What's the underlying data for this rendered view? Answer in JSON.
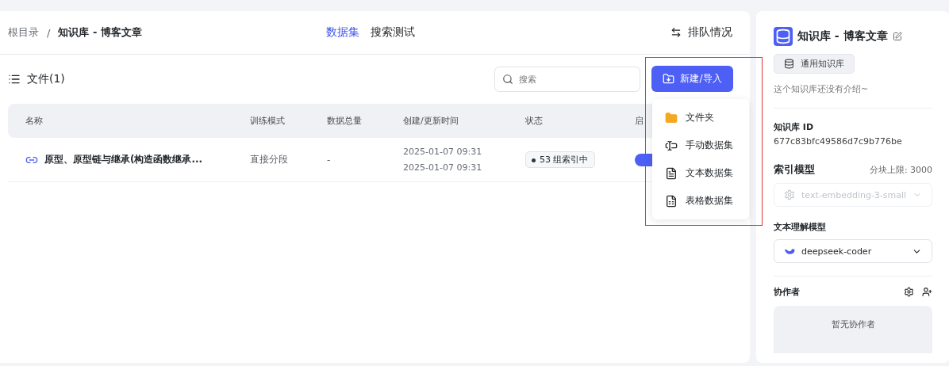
{
  "breadcrumb_separator": "/",
  "breadcrumb": [
    {
      "label": "根目录",
      "current": false
    },
    {
      "label": "知识库 - 博客文章",
      "current": true
    }
  ],
  "tabs": [
    {
      "label": "数据集",
      "selected": true
    },
    {
      "label": "搜索测试",
      "selected": false
    }
  ],
  "queue_button": {
    "label": "排队情况"
  },
  "files_heading": "文件(1)",
  "search": {
    "placeholder": "搜索"
  },
  "create_button": {
    "label": "新建/导入"
  },
  "create_menu": [
    {
      "kind": "folder",
      "label": "文件夹"
    },
    {
      "kind": "manual",
      "label": "手动数据集"
    },
    {
      "kind": "text",
      "label": "文本数据集"
    },
    {
      "kind": "table",
      "label": "表格数据集"
    }
  ],
  "table": {
    "columns": [
      "名称",
      "训练模式",
      "数据总量",
      "创建/更新时间",
      "状态",
      "启"
    ],
    "rows": [
      {
        "name": "原型、原型链与继承(构造函数继承...",
        "mode": "直接分段",
        "total": "-",
        "created": "2025-01-07 09:31",
        "updated": "2025-01-07 09:31",
        "status": "53 组索引中",
        "enabled": true
      }
    ]
  },
  "sidebar": {
    "title": "知识库 - 博客文章",
    "type_tag": "通用知识库",
    "description": "这个知识库还没有介绍~",
    "id_label": "知识库 ID",
    "id_value": "677c83bfc49586d7c9b776be",
    "index_model": {
      "label": "索引模型",
      "limit": "分块上限: 3000",
      "value": "text-embedding-3-small",
      "disabled": true
    },
    "text_model": {
      "label": "文本理解模型",
      "value": "deepseek-coder",
      "disabled": false
    },
    "collaborators": {
      "label": "协作者",
      "empty_text": "暂无协作者"
    }
  }
}
